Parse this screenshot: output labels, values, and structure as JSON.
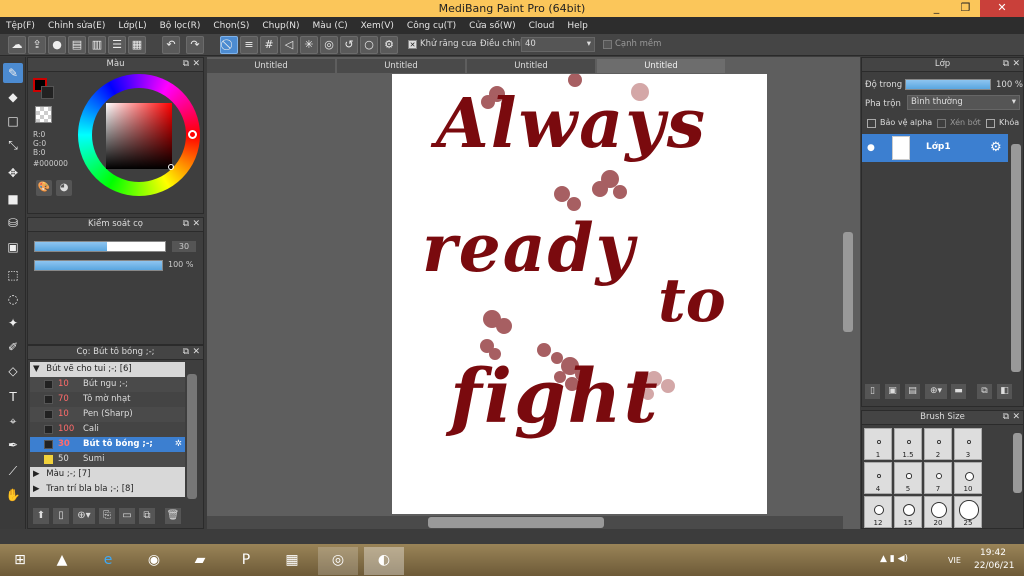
{
  "window": {
    "title": "MediBang Paint Pro (64bit)",
    "minimize": "_",
    "restore": "❐",
    "close": "✕"
  },
  "menu": [
    "Tệp(F)",
    "Chỉnh sửa(E)",
    "Lớp(L)",
    "Bộ lọc(R)",
    "Chọn(S)",
    "Chụp(N)",
    "Màu (C)",
    "Xem(V)",
    "Công cụ(T)",
    "Cửa số(W)",
    "Cloud",
    "Help"
  ],
  "toolbar": {
    "antialias_label": "Khử răng cưa",
    "adjust_label": "Điều chỉnh",
    "adjust_value": "40",
    "edge_label": "Cạnh mềm"
  },
  "color_panel": {
    "title": "Màu",
    "r": "R:0",
    "g": "G:0",
    "b": "B:0",
    "hex": "#000000",
    "primary_color": "#8b0000"
  },
  "brush_control": {
    "title": "Kiểm soát cọ",
    "size": "30",
    "opacity": "100 %",
    "size_fill": 0.55,
    "opacity_fill": 1.0
  },
  "brush_panel": {
    "title": "Cọ: Bút tô bóng ;-;",
    "group1": "Bút vẽ cho tui ;-; [6]",
    "brushes": [
      {
        "num": "10",
        "name": "Bút ngu ;-;"
      },
      {
        "num": "70",
        "name": "Tô mờ nhạt"
      },
      {
        "num": "10",
        "name": "Pen (Sharp)"
      },
      {
        "num": "100",
        "name": "Cali"
      },
      {
        "num": "30",
        "name": "Bút tô bóng ;-;"
      },
      {
        "num": "50",
        "name": "Sumi"
      }
    ],
    "group2": "Màu ;-; [7]",
    "group3": "Tran trí bla bla ;-; [8]"
  },
  "tabs": [
    "Untitled",
    "Untitled",
    "Untitled",
    "Untitled"
  ],
  "canvas_text": {
    "line1": "Always",
    "line2": "ready",
    "line3": "to",
    "line4": "fight"
  },
  "layer_panel": {
    "title": "Lớp",
    "opacity_label": "Độ trong",
    "opacity_value": "100 %",
    "blend_label": "Pha trộn",
    "blend_value": "Bình thường",
    "protect_alpha": "Bảo vệ alpha",
    "clip": "Xén bớt",
    "lock": "Khóa",
    "layer_name": "Lớp1"
  },
  "brush_size_panel": {
    "title": "Brush Size",
    "labels": [
      "1",
      "1.5",
      "2",
      "3",
      "4",
      "5",
      "7",
      "10",
      "12",
      "15",
      "20",
      "25"
    ]
  },
  "taskbar": {
    "lang": "VIE",
    "time": "19:42",
    "date": "22/06/21"
  }
}
